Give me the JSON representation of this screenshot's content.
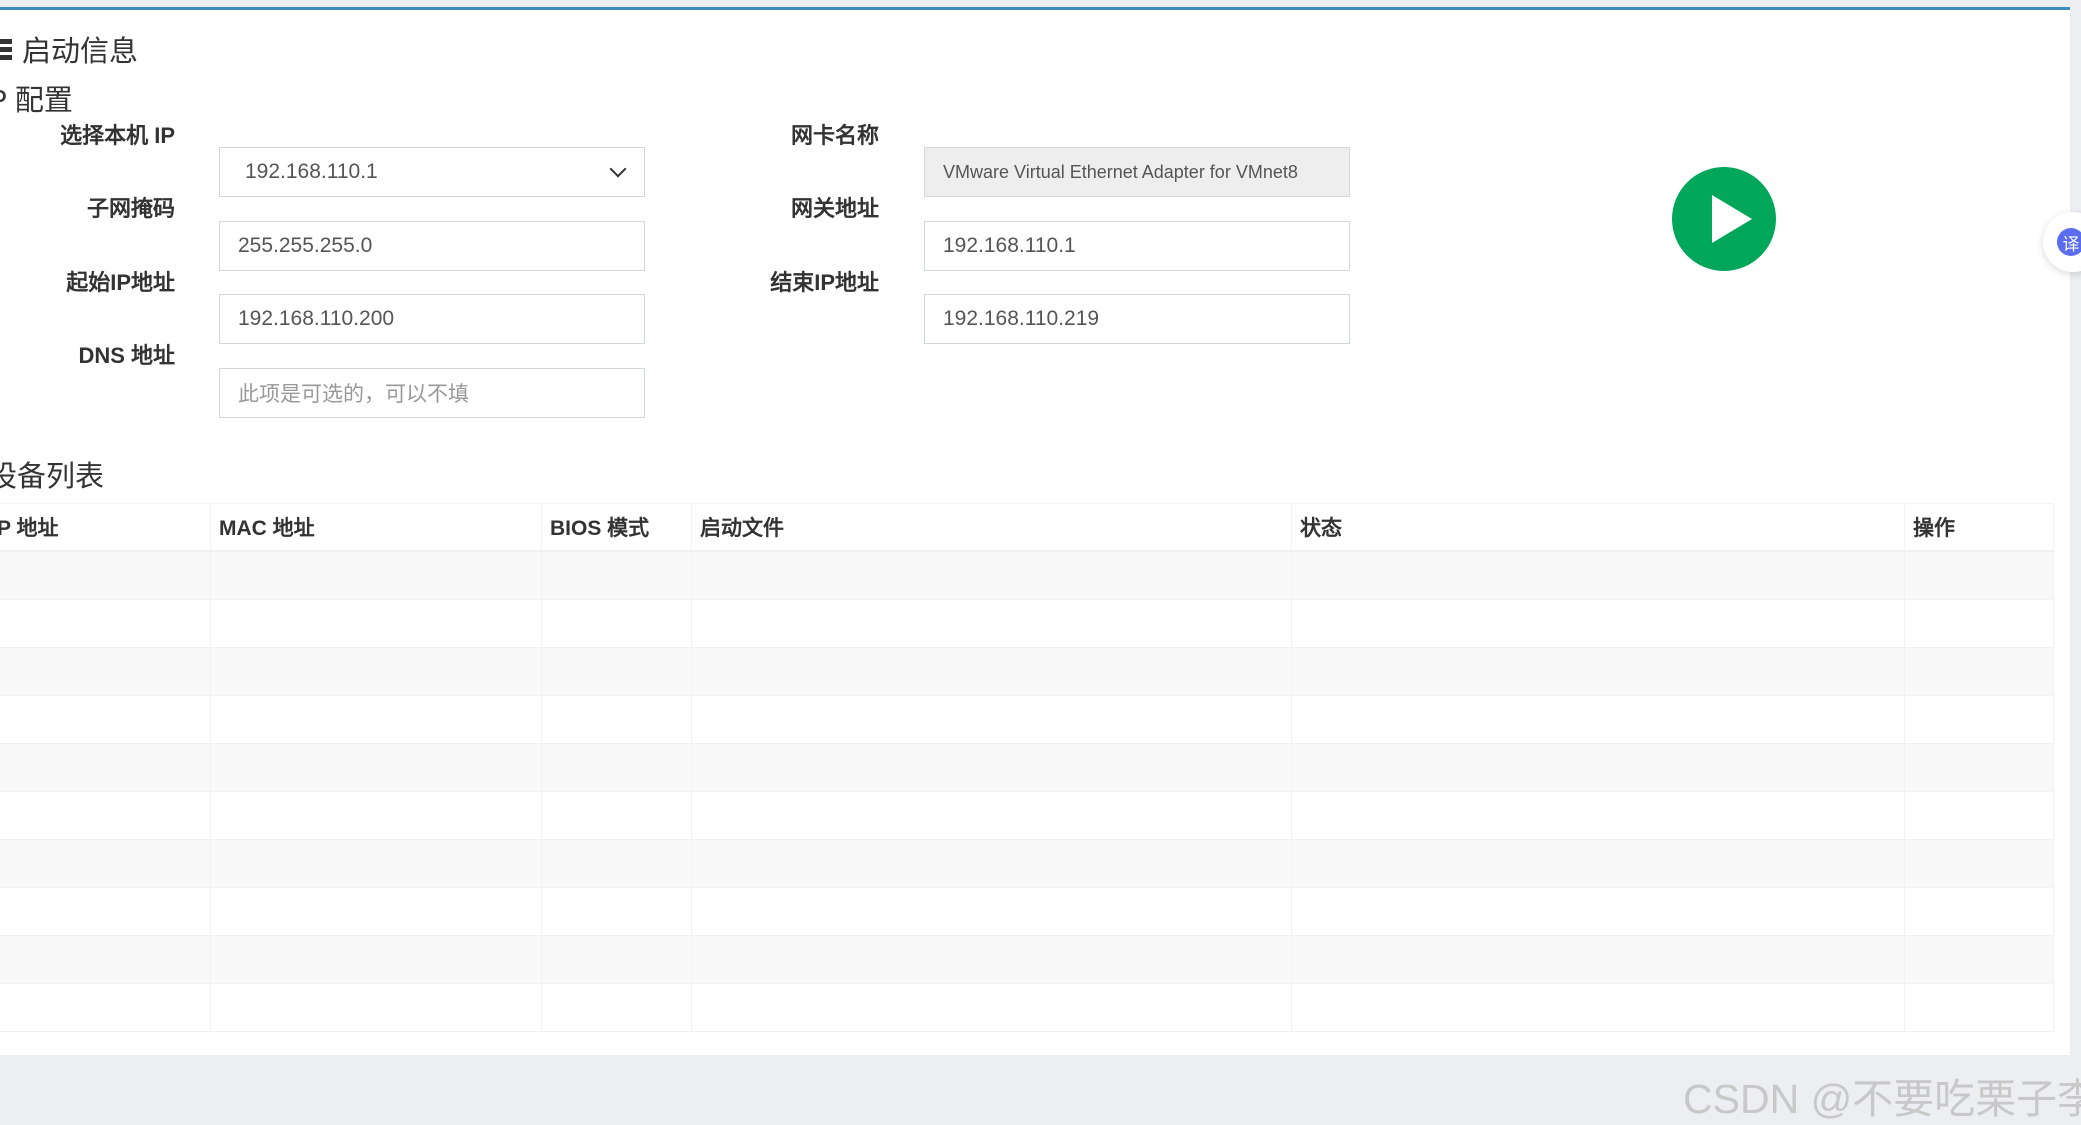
{
  "panel": {
    "title": "启动信息",
    "title_icon": "server-icon"
  },
  "ip_config": {
    "section_title": "P 配置",
    "local_ip_label": "选择本机 IP",
    "local_ip_value": "192.168.110.1",
    "nic_name_label": "网卡名称",
    "nic_name_value": "VMware Virtual Ethernet Adapter for VMnet8",
    "subnet_mask_label": "子网掩码",
    "subnet_mask_value": "255.255.255.0",
    "gateway_label": "网关地址",
    "gateway_value": "192.168.110.1",
    "start_ip_label": "起始IP地址",
    "start_ip_value": "192.168.110.200",
    "end_ip_label": "结束IP地址",
    "end_ip_value": "192.168.110.219",
    "dns_label": "DNS 地址",
    "dns_placeholder": "此项是可选的，可以不填",
    "play_icon": "play-icon",
    "play_color": "#00a65a"
  },
  "device_list": {
    "section_title": "设备列表",
    "columns": [
      "P 地址",
      "MAC 地址",
      "BIOS 模式",
      "启动文件",
      "状态",
      "操作"
    ],
    "rows": [
      [
        "",
        "",
        "",
        "",
        "",
        ""
      ],
      [
        "",
        "",
        "",
        "",
        "",
        ""
      ],
      [
        "",
        "",
        "",
        "",
        "",
        ""
      ],
      [
        "",
        "",
        "",
        "",
        "",
        ""
      ],
      [
        "",
        "",
        "",
        "",
        "",
        ""
      ],
      [
        "",
        "",
        "",
        "",
        "",
        ""
      ],
      [
        "",
        "",
        "",
        "",
        "",
        ""
      ],
      [
        "",
        "",
        "",
        "",
        "",
        ""
      ],
      [
        "",
        "",
        "",
        "",
        "",
        ""
      ],
      [
        "",
        "",
        "",
        "",
        "",
        ""
      ]
    ]
  },
  "translate_widget": {
    "label": "译"
  },
  "watermark": "CSDN @不要吃栗子李",
  "colors": {
    "accent": "#3c8dbc",
    "page_background": "#eceef1"
  }
}
